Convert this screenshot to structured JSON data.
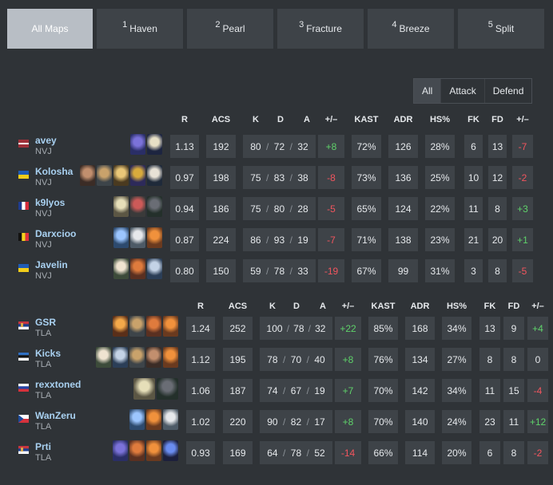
{
  "map_tabs": [
    {
      "num": "",
      "label": "All Maps",
      "active": true
    },
    {
      "num": "1",
      "label": "Haven",
      "active": false
    },
    {
      "num": "2",
      "label": "Pearl",
      "active": false
    },
    {
      "num": "3",
      "label": "Fracture",
      "active": false
    },
    {
      "num": "4",
      "label": "Breeze",
      "active": false
    },
    {
      "num": "5",
      "label": "Split",
      "active": false
    }
  ],
  "side_toggle": [
    {
      "label": "All",
      "active": true
    },
    {
      "label": "Attack",
      "active": false
    },
    {
      "label": "Defend",
      "active": false
    }
  ],
  "columns": {
    "r": "R",
    "acs": "ACS",
    "k": "K",
    "d": "D",
    "a": "A",
    "pm": "+/–",
    "kast": "KAST",
    "adr": "ADR",
    "hs": "HS%",
    "fk": "FK",
    "fd": "FD",
    "fkfd": "+/–"
  },
  "teams": [
    {
      "players": [
        {
          "name": "avey",
          "team": "NVJ",
          "flag": "latvia",
          "agents": [
            "omen-icon",
            "neon-icon"
          ],
          "r": "1.13",
          "acs": "192",
          "k": "80",
          "d": "72",
          "a": "32",
          "pm": "+8",
          "kast": "72%",
          "adr": "126",
          "hs": "28%",
          "fk": "6",
          "fd": "13",
          "fkfd": "-7"
        },
        {
          "name": "Kolosha",
          "team": "NVJ",
          "flag": "ukraine",
          "agents": [
            "fade-icon",
            "kayo-icon",
            "chamber-icon",
            "astra-icon",
            "harbor-icon"
          ],
          "r": "0.97",
          "acs": "198",
          "k": "75",
          "d": "83",
          "a": "38",
          "pm": "-8",
          "kast": "73%",
          "adr": "136",
          "hs": "25%",
          "fk": "10",
          "fd": "12",
          "fkfd": "-2"
        },
        {
          "name": "k9lyos",
          "team": "NVJ",
          "flag": "france",
          "agents": [
            "killjoy-icon",
            "cypher-icon",
            "viper-icon"
          ],
          "r": "0.94",
          "acs": "186",
          "k": "75",
          "d": "80",
          "a": "28",
          "pm": "-5",
          "kast": "65%",
          "adr": "124",
          "hs": "22%",
          "fk": "11",
          "fd": "8",
          "fkfd": "+3"
        },
        {
          "name": "Darxcioo",
          "team": "NVJ",
          "flag": "belgium",
          "agents": [
            "jett-icon",
            "sage-icon",
            "raze-icon"
          ],
          "r": "0.87",
          "acs": "224",
          "k": "86",
          "d": "93",
          "a": "19",
          "pm": "-7",
          "kast": "71%",
          "adr": "138",
          "hs": "23%",
          "fk": "21",
          "fd": "20",
          "fkfd": "+1"
        },
        {
          "name": "Javelin",
          "team": "NVJ",
          "flag": "ukraine",
          "agents": [
            "skye-icon",
            "breach-icon",
            "sova-icon"
          ],
          "r": "0.80",
          "acs": "150",
          "k": "59",
          "d": "78",
          "a": "33",
          "pm": "-19",
          "kast": "67%",
          "adr": "99",
          "hs": "31%",
          "fk": "3",
          "fd": "8",
          "fkfd": "-5"
        }
      ]
    },
    {
      "players": [
        {
          "name": "GSR",
          "team": "TLA",
          "flag": "serbia",
          "agents": [
            "phoenix-icon",
            "kayo-icon",
            "breach-icon",
            "raze-icon"
          ],
          "r": "1.24",
          "acs": "252",
          "k": "100",
          "d": "78",
          "a": "32",
          "pm": "+22",
          "kast": "85%",
          "adr": "168",
          "hs": "34%",
          "fk": "13",
          "fd": "9",
          "fkfd": "+4"
        },
        {
          "name": "Kicks",
          "team": "TLA",
          "flag": "estonia",
          "agents": [
            "skye-icon",
            "sova-icon",
            "kayo-icon",
            "fade-icon",
            "raze-icon"
          ],
          "r": "1.12",
          "acs": "195",
          "k": "78",
          "d": "70",
          "a": "40",
          "pm": "+8",
          "kast": "76%",
          "adr": "134",
          "hs": "27%",
          "fk": "8",
          "fd": "8",
          "fkfd": "0"
        },
        {
          "name": "rexxtoned",
          "team": "TLA",
          "flag": "russia",
          "agents": [
            "killjoy-icon",
            "viper-icon"
          ],
          "r": "1.06",
          "acs": "187",
          "k": "74",
          "d": "67",
          "a": "19",
          "pm": "+7",
          "kast": "70%",
          "adr": "142",
          "hs": "34%",
          "fk": "11",
          "fd": "15",
          "fkfd": "-4"
        },
        {
          "name": "WanZeru",
          "team": "TLA",
          "flag": "czechia",
          "agents": [
            "jett-icon",
            "raze-icon",
            "sage-icon"
          ],
          "r": "1.02",
          "acs": "220",
          "k": "90",
          "d": "82",
          "a": "17",
          "pm": "+8",
          "kast": "70%",
          "adr": "140",
          "hs": "24%",
          "fk": "23",
          "fd": "11",
          "fkfd": "+12"
        },
        {
          "name": "Prti",
          "team": "TLA",
          "flag": "serbia",
          "agents": [
            "omen-icon",
            "breach-icon",
            "raze-icon",
            "yoru-icon"
          ],
          "r": "0.93",
          "acs": "169",
          "k": "64",
          "d": "78",
          "a": "52",
          "pm": "-14",
          "kast": "66%",
          "adr": "114",
          "hs": "20%",
          "fk": "6",
          "fd": "8",
          "fkfd": "-2"
        }
      ]
    }
  ]
}
